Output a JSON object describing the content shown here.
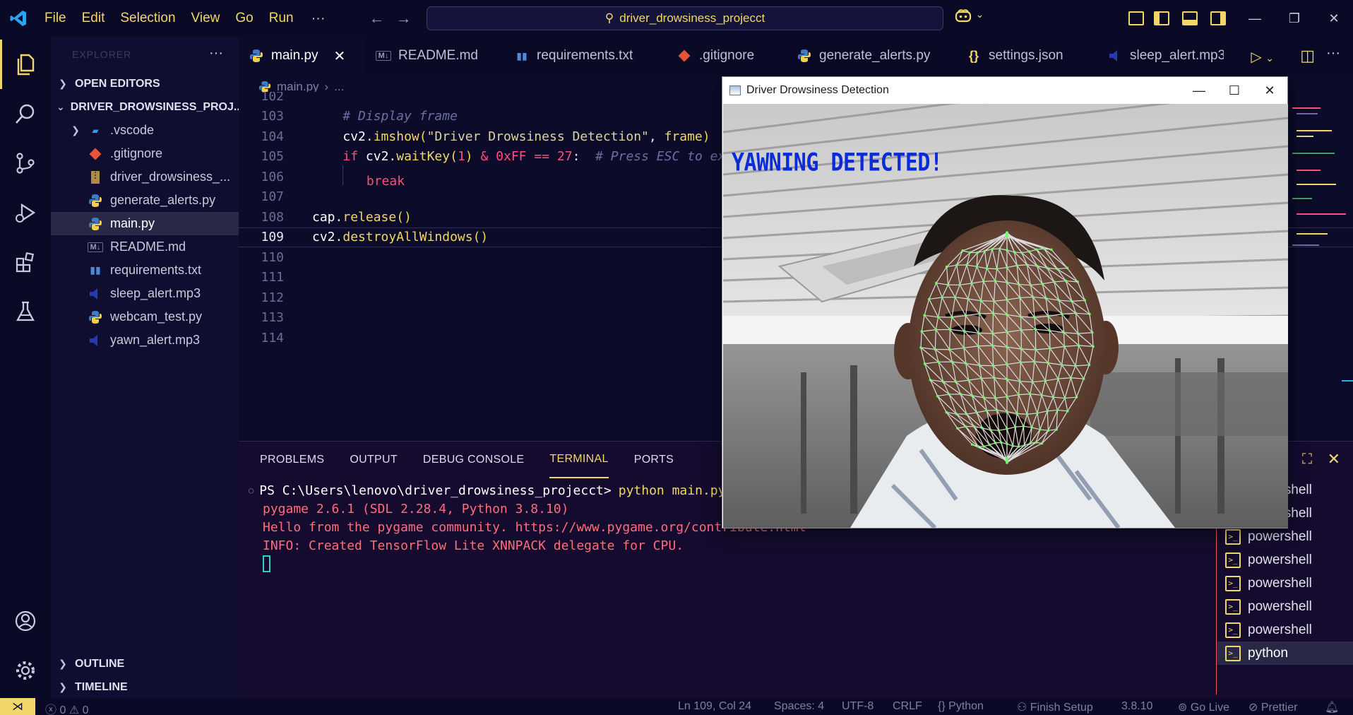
{
  "titlebar": {
    "menus": [
      "File",
      "Edit",
      "Selection",
      "View",
      "Go",
      "Run"
    ],
    "more": "···",
    "search_text": "driver_drowsiness_projecct",
    "copilot_chevron": "⌄"
  },
  "sidebar": {
    "header": "EXPLORER",
    "open_editors": "OPEN EDITORS",
    "project": "DRIVER_DROWSINESS_PROJ...",
    "files": [
      {
        "name": ".vscode",
        "type": "folder"
      },
      {
        "name": ".gitignore",
        "type": "git"
      },
      {
        "name": "driver_drowsiness_...",
        "type": "archive"
      },
      {
        "name": "generate_alerts.py",
        "type": "python"
      },
      {
        "name": "main.py",
        "type": "python"
      },
      {
        "name": "README.md",
        "type": "markdown"
      },
      {
        "name": "requirements.txt",
        "type": "pip"
      },
      {
        "name": "sleep_alert.mp3",
        "type": "audio"
      },
      {
        "name": "webcam_test.py",
        "type": "python"
      },
      {
        "name": "yawn_alert.mp3",
        "type": "audio"
      }
    ],
    "outline": "OUTLINE",
    "timeline": "TIMELINE"
  },
  "tabs": [
    {
      "label": "main.py",
      "type": "python",
      "active": true
    },
    {
      "label": "README.md",
      "type": "markdown"
    },
    {
      "label": "requirements.txt",
      "type": "pip"
    },
    {
      "label": ".gitignore",
      "type": "git"
    },
    {
      "label": "generate_alerts.py",
      "type": "python"
    },
    {
      "label": "settings.json",
      "type": "json"
    },
    {
      "label": "sleep_alert.mp3",
      "type": "audio"
    }
  ],
  "breadcrumb": {
    "file": "main.py",
    "rest": "..."
  },
  "editor": {
    "line_numbers": [
      "102",
      "103",
      "104",
      "105",
      "106",
      "107",
      "108",
      "109",
      "110",
      "111",
      "112",
      "113",
      "114"
    ],
    "current_line": "109"
  },
  "panel": {
    "tabs": [
      "PROBLEMS",
      "OUTPUT",
      "DEBUG CONSOLE",
      "TERMINAL",
      "PORTS"
    ],
    "active_tab": "TERMINAL",
    "terminal": {
      "prompt": "PS C:\\Users\\lenovo\\driver_drowsiness_projecct>",
      "command": "python main.py",
      "output": [
        "pygame 2.6.1 (SDL 2.28.4, Python 3.8.10)",
        "Hello from the pygame community. https://www.pygame.org/contribute.html",
        "INFO: Created TensorFlow Lite XNNPACK delegate for CPU."
      ]
    },
    "terminals": [
      "powershell",
      "powershell",
      "powershell",
      "powershell",
      "powershell",
      "powershell",
      "powershell",
      "python"
    ]
  },
  "statusbar": {
    "errors": "0",
    "warnings": "0",
    "position": "Ln 109, Col 24",
    "spaces": "Spaces: 4",
    "encoding": "UTF-8",
    "eol": "CRLF",
    "language": "Python",
    "finish_setup": "Finish Setup",
    "python_version": "3.8.10",
    "go_live": "Go Live",
    "prettier": "Prettier"
  },
  "cv_window": {
    "title": "Driver Drowsiness Detection",
    "overlay_text": "YAWNING DETECTED!"
  },
  "colors": {
    "accent": "#f2d66a",
    "background": "#0c0b2a",
    "overlay_text": "#0a2bd8",
    "mesh": "#6dfb6d"
  }
}
